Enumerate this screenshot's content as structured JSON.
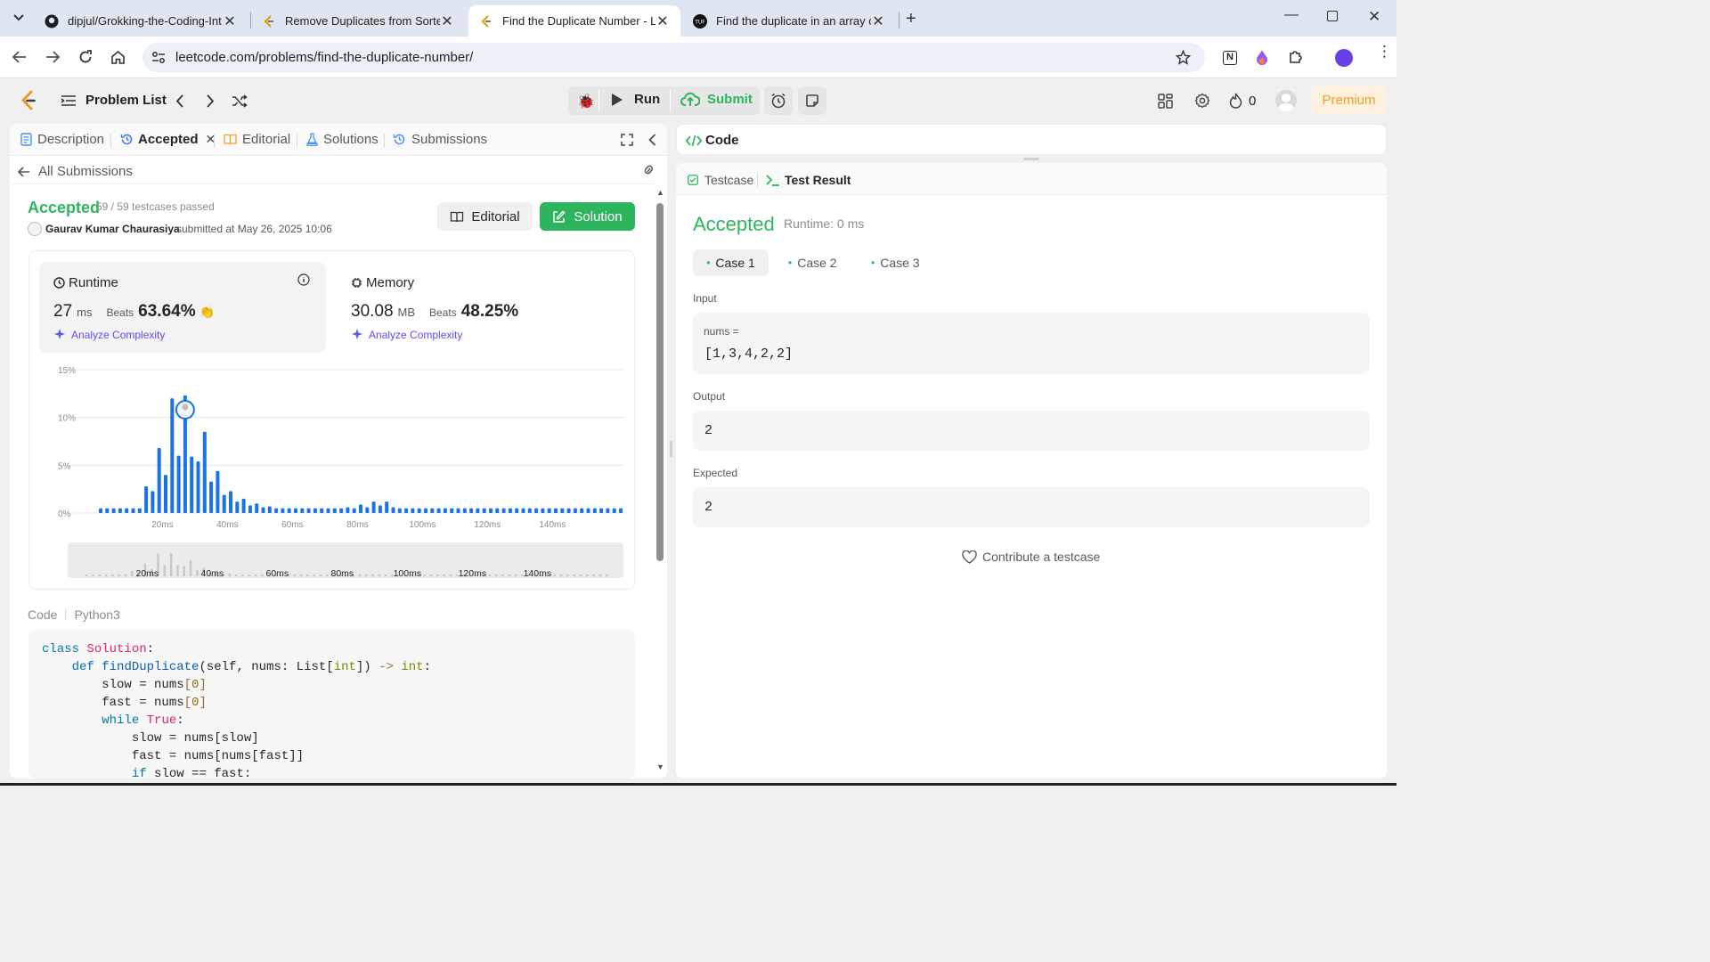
{
  "browser": {
    "tabs": [
      {
        "title": "dipjul/Grokking-the-Coding-Int",
        "icon": "github-icon"
      },
      {
        "title": "Remove Duplicates from Sorted",
        "icon": "leetcode-icon"
      },
      {
        "title": "Find the Duplicate Number - Le",
        "icon": "leetcode-icon",
        "active": true
      },
      {
        "title": "Find the duplicate in an array of",
        "icon": "tuf-icon"
      }
    ],
    "url": "leetcode.com/problems/find-the-duplicate-number/"
  },
  "app": {
    "problem_list_label": "Problem List",
    "run_label": "Run",
    "submit_label": "Submit",
    "streak_count": "0",
    "premium_label": "Premium"
  },
  "left_tabs": [
    {
      "label": "Description",
      "icon": "description-icon"
    },
    {
      "label": "Accepted",
      "icon": "history-icon",
      "closable": true,
      "active": true
    },
    {
      "label": "Editorial",
      "icon": "book-icon"
    },
    {
      "label": "Solutions",
      "icon": "flask-icon"
    },
    {
      "label": "Submissions",
      "icon": "history-icon"
    }
  ],
  "submission": {
    "back_label": "All Submissions",
    "status": "Accepted",
    "testcases": "59 / 59 testcases passed",
    "author": "Gaurav Kumar Chaurasiya",
    "submitted_at": "submitted at May 26, 2025 10:06",
    "editorial_btn": "Editorial",
    "solution_btn": "Solution",
    "runtime": {
      "title": "Runtime",
      "value": "27",
      "unit": "ms",
      "beats_label": "Beats",
      "beats": "63.64%",
      "analyze": "Analyze Complexity"
    },
    "memory": {
      "title": "Memory",
      "value": "30.08",
      "unit": "MB",
      "beats_label": "Beats",
      "beats": "48.25%",
      "analyze": "Analyze Complexity"
    }
  },
  "chart_data": {
    "type": "bar",
    "xlabel": "",
    "ylabel": "",
    "ylim": [
      0,
      15
    ],
    "y_ticks": [
      "15%",
      "10%",
      "5%",
      "0%"
    ],
    "x_ticks": [
      "20ms",
      "40ms",
      "60ms",
      "80ms",
      "100ms",
      "120ms",
      "140ms"
    ],
    "x_range_ms": [
      0,
      160
    ],
    "grid": true,
    "bar_color": "#1a73e8",
    "highlight_ms": 27,
    "series": [
      {
        "values": [
          0.5,
          0.5,
          0.5,
          0.5,
          0.5,
          0.5,
          0.5,
          2.8,
          2.3,
          6.8,
          4.0,
          12.0,
          6.0,
          12.3,
          5.9,
          5.4,
          8.5,
          3.3,
          4.4,
          1.9,
          2.3,
          1.2,
          1.5,
          0.8,
          1.0,
          0.6,
          0.7,
          0.5,
          0.5,
          0.5,
          0.5,
          0.5,
          0.5,
          0.5,
          0.5,
          0.5,
          0.5,
          0.5,
          0.6,
          0.5,
          0.9,
          0.6,
          1.2,
          0.8,
          1.2,
          0.6,
          0.5,
          0.5,
          0.5,
          0.5,
          0.5,
          0.5,
          0.5,
          0.5,
          0.5,
          0.5,
          0.5,
          0.5,
          0.5,
          0.5,
          0.5,
          0.5,
          0.5,
          0.5,
          0.5,
          0.5,
          0.5,
          0.5,
          0.5,
          0.5,
          0.5,
          0.5,
          0.5,
          0.5,
          0.5,
          0.5,
          0.5,
          0.5,
          0.5,
          0.5,
          0.5
        ]
      }
    ],
    "overview_ticks": [
      "20ms",
      "40ms",
      "60ms",
      "80ms",
      "100ms",
      "120ms",
      "140ms"
    ]
  },
  "code_section": {
    "label": "Code",
    "language": "Python3",
    "lines": [
      "class Solution:",
      "    def findDuplicate(self, nums: List[int]) -> int:",
      "        slow = nums[0]",
      "        fast = nums[0]",
      "        while True:",
      "            slow = nums[slow]",
      "            fast = nums[nums[fast]]",
      "            if slow == fast:"
    ]
  },
  "right_panel": {
    "code_tab": "Code",
    "testcase_tab": "Testcase",
    "test_result_tab": "Test Result",
    "result_status": "Accepted",
    "runtime_text": "Runtime: 0 ms",
    "cases": [
      "Case 1",
      "Case 2",
      "Case 3"
    ],
    "input_label": "Input",
    "input_var": "nums =",
    "input_value": "[1,3,4,2,2]",
    "output_label": "Output",
    "output_value": "2",
    "expected_label": "Expected",
    "expected_value": "2",
    "contribute": "Contribute a testcase"
  },
  "colors": {
    "accent_green": "#2db55d",
    "premium_bg": "#fff1e0",
    "premium_text": "#f0a020",
    "link_purple": "#6b4cf6"
  }
}
